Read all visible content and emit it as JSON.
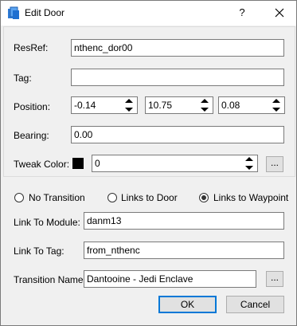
{
  "window": {
    "title": "Edit Door",
    "help_label": "?"
  },
  "fields": {
    "resref": {
      "label": "ResRef:",
      "value": "nthenc_dor00"
    },
    "tag": {
      "label": "Tag:",
      "value": ""
    },
    "position": {
      "label": "Position:",
      "x": "-0.14",
      "y": "10.75",
      "z": "0.08"
    },
    "bearing": {
      "label": "Bearing:",
      "value": "0.00"
    },
    "tweak_color": {
      "label": "Tweak Color:",
      "value": "0",
      "swatch": "#000000",
      "browse_label": "..."
    }
  },
  "transition": {
    "options": [
      {
        "label": "No Transition",
        "selected": false
      },
      {
        "label": "Links to Door",
        "selected": false
      },
      {
        "label": "Links to Waypoint",
        "selected": true
      }
    ],
    "module": {
      "label": "Link To Module:",
      "value": "danm13"
    },
    "tag": {
      "label": "Link To Tag:",
      "value": "from_nthenc"
    },
    "name": {
      "label": "Transition Name:",
      "value": "Dantooine - Jedi Enclave",
      "browse_label": "..."
    }
  },
  "buttons": {
    "ok": "OK",
    "cancel": "Cancel"
  }
}
